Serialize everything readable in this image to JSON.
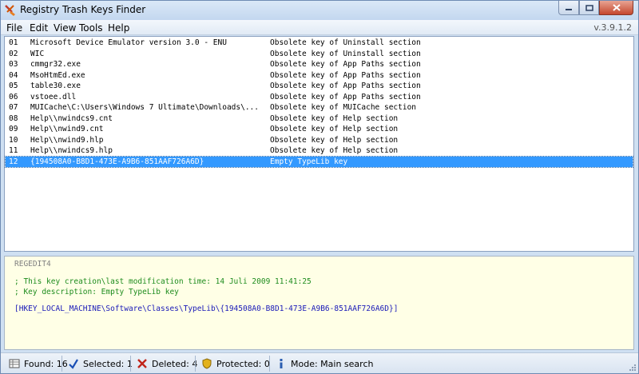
{
  "window": {
    "title": "Registry Trash Keys Finder",
    "version": "v.3.9.1.2"
  },
  "menu": [
    "File",
    "Edit",
    "View",
    "Tools",
    "Help"
  ],
  "list": {
    "rows": [
      {
        "num": "01",
        "key": "Microsoft Device Emulator version 3.0 - ENU",
        "desc": "Obsolete key of Uninstall section"
      },
      {
        "num": "02",
        "key": "WIC",
        "desc": "Obsolete key of Uninstall section"
      },
      {
        "num": "03",
        "key": "cmmgr32.exe",
        "desc": "Obsolete key of App Paths section"
      },
      {
        "num": "04",
        "key": "MsoHtmEd.exe",
        "desc": "Obsolete key of App Paths section"
      },
      {
        "num": "05",
        "key": "table30.exe",
        "desc": "Obsolete key of App Paths section"
      },
      {
        "num": "06",
        "key": "vstoee.dll",
        "desc": "Obsolete key of App Paths section"
      },
      {
        "num": "07",
        "key": "MUICache\\C:\\Users\\Windows 7 Ultimate\\Downloads\\...",
        "desc": "Obsolete key of MUICache section"
      },
      {
        "num": "08",
        "key": "Help\\\\nwindcs9.cnt",
        "desc": "Obsolete key of Help section"
      },
      {
        "num": "09",
        "key": "Help\\\\nwind9.cnt",
        "desc": "Obsolete key of Help section"
      },
      {
        "num": "10",
        "key": "Help\\\\nwind9.hlp",
        "desc": "Obsolete key of Help section"
      },
      {
        "num": "11",
        "key": "Help\\\\nwindcs9.hlp",
        "desc": "Obsolete key of Help section"
      },
      {
        "num": "12",
        "key": "{194508A0-B8D1-473E-A9B6-851AAF726A6D}",
        "desc": "Empty TypeLib key"
      }
    ],
    "selected_index": 11
  },
  "details": {
    "header": "REGEDIT4",
    "comment1": "; This key creation\\last modification time: 14 Juli 2009 11:41:25",
    "comment2": "; Key description: Empty TypeLib key",
    "key": "[HKEY_LOCAL_MACHINE\\Software\\Classes\\TypeLib\\{194508A0-B8D1-473E-A9B6-851AAF726A6D}]"
  },
  "status": {
    "found": "Found: 16",
    "selected": "Selected: 1",
    "deleted": "Deleted: 4",
    "protected": "Protected: 0",
    "mode": "Mode: Main search"
  },
  "icons": {
    "app": "registry-broom-icon",
    "found": "grid-icon",
    "selected": "checkmark-icon",
    "deleted": "x-icon",
    "protected": "shield-icon",
    "mode": "info-icon"
  },
  "colors": {
    "selection": "#3399ff",
    "details_bg": "#ffffe6",
    "comment": "#1e8c1e",
    "key": "#1a1ab8"
  }
}
